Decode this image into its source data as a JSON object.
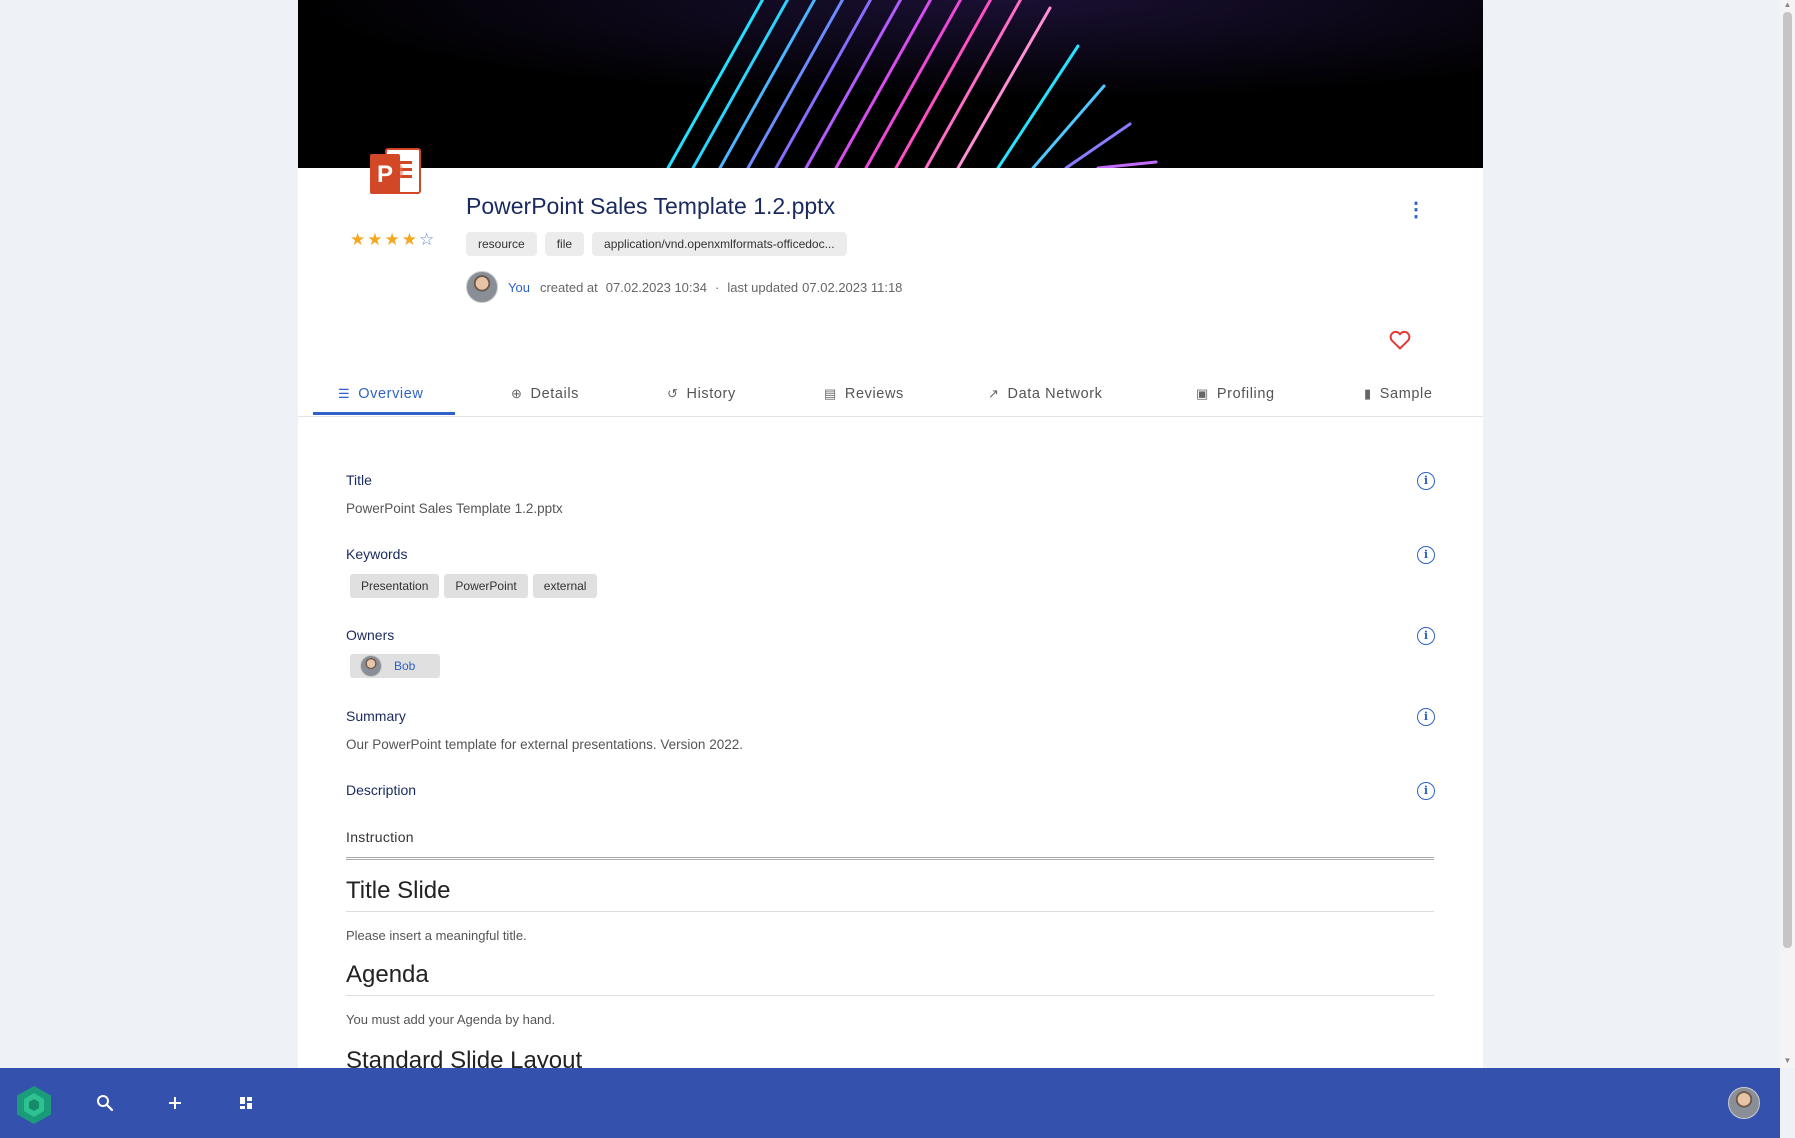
{
  "resource": {
    "title": "PowerPoint Sales Template 1.2.pptx",
    "rating": 4,
    "rating_max": 5,
    "tags": [
      "resource",
      "file",
      "application/vnd.openxmlformats-officedoc..."
    ],
    "creator": "You",
    "created_label": "created at",
    "created_at": "07.02.2023 10:34",
    "separator": "·",
    "updated_label": "last updated",
    "updated_at": "07.02.2023 11:18"
  },
  "tabs": [
    {
      "label": "Overview",
      "icon": "lines-icon",
      "active": true
    },
    {
      "label": "Details",
      "icon": "clock-plus-icon"
    },
    {
      "label": "History",
      "icon": "history-icon"
    },
    {
      "label": "Reviews",
      "icon": "chat-icon"
    },
    {
      "label": "Data Network",
      "icon": "trend-icon"
    },
    {
      "label": "Profiling",
      "icon": "profile-icon"
    },
    {
      "label": "Sample",
      "icon": "document-icon"
    }
  ],
  "overview": {
    "title_label": "Title",
    "title_value": "PowerPoint Sales Template 1.2.pptx",
    "keywords_label": "Keywords",
    "keywords": [
      "Presentation",
      "PowerPoint",
      "external"
    ],
    "owners_label": "Owners",
    "owners": [
      "Bob"
    ],
    "summary_label": "Summary",
    "summary_value": "Our PowerPoint template for external presentations. Version 2022.",
    "description_label": "Description"
  },
  "description": {
    "instruction": "Instruction",
    "sections": [
      {
        "heading": "Title Slide",
        "text": "Please insert a meaningful title."
      },
      {
        "heading": "Agenda",
        "text": "You must add your Agenda by hand."
      },
      {
        "heading": "Standard Slide Layout",
        "text": ""
      }
    ]
  },
  "colors": {
    "accent": "#2f62c9",
    "title": "#1a2a5e",
    "bottom_bar": "#3451ad",
    "star": "#f5a623",
    "heart": "#e53935",
    "powerpoint": "#d24726"
  },
  "icons": {
    "file": "powerpoint-file-icon",
    "menu": "kebab-menu-icon",
    "favorite": "heart-icon",
    "info": "info-icon",
    "bottom_bar": [
      "app-logo-icon",
      "search-icon",
      "plus-icon",
      "dashboard-icon",
      "user-avatar"
    ]
  }
}
